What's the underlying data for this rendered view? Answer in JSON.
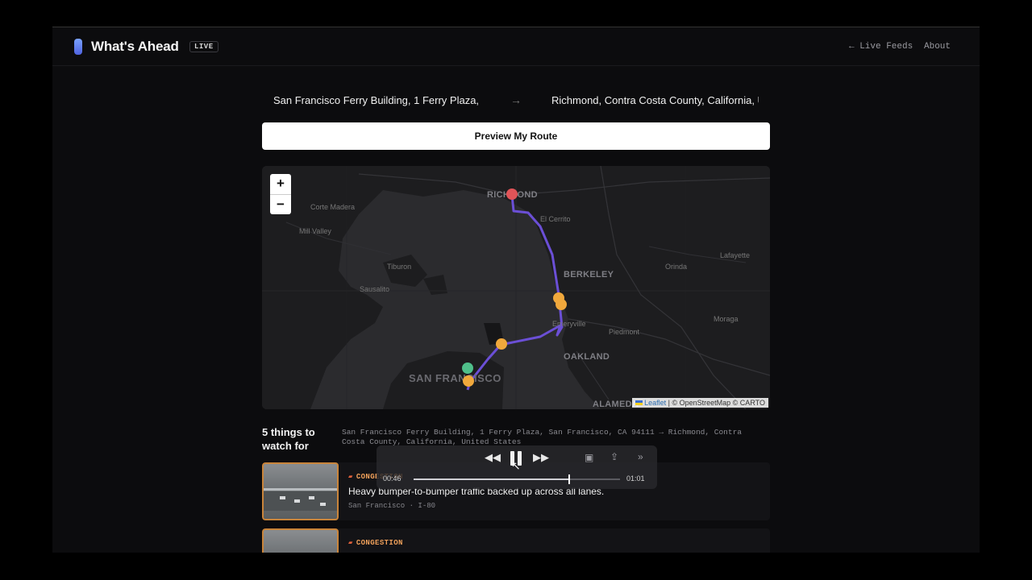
{
  "header": {
    "title": "What's Ahead",
    "badge": "LIVE",
    "nav": {
      "feeds": "← Live Feeds",
      "about": "About"
    }
  },
  "route": {
    "origin": "San Francisco Ferry Building, 1 Ferry Plaza, San Francisco, CA 94111",
    "destination": "Richmond, Contra Costa County, California, United States",
    "preview_label": "Preview My Route"
  },
  "map": {
    "zoom_in": "+",
    "zoom_out": "−",
    "labels": {
      "richmond": "RICHMOND",
      "el_cerrito": "El Cerrito",
      "corte_madera": "Corte Madera",
      "mill_valley": "Mill Valley",
      "tiburon": "Tiburon",
      "berkeley": "BERKELEY",
      "orinda": "Orinda",
      "lafayette": "Lafayette",
      "sausalito": "Sausalito",
      "emeryville": "Emeryville",
      "piedmont": "Piedmont",
      "moraga": "Moraga",
      "oakland": "OAKLAND",
      "san_francisco": "SAN FRANCISCO",
      "alameda": "ALAMEDA"
    },
    "attribution": {
      "leaflet": "Leaflet",
      "rest": "| © OpenStreetMap © CARTO"
    },
    "colors": {
      "route": "#6b4fd6",
      "start": "#4fbf8a",
      "end": "#e05458",
      "alert": "#f0a83c"
    }
  },
  "section": {
    "title": "5 things to watch for",
    "route_text": "San Francisco Ferry Building, 1 Ferry Plaza, San Francisco, CA 94111 → Richmond, Contra Costa County, California, United States"
  },
  "items": [
    {
      "tag": "CONGESTION",
      "text": "Heavy bumper-to-bumper traffic backed up across all lanes.",
      "meta": "San Francisco · I-80"
    },
    {
      "tag": "CONGESTION"
    }
  ],
  "player": {
    "current": "00:46",
    "duration": "01:01",
    "progress": 0.754
  }
}
